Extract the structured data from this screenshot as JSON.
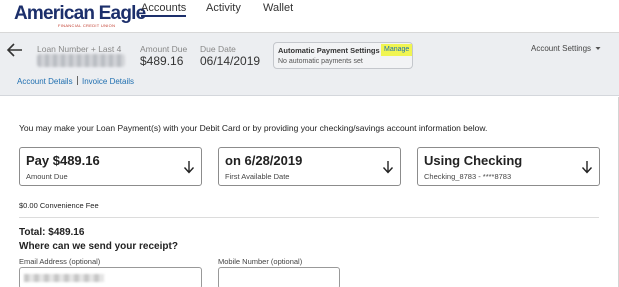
{
  "brand": {
    "name": "American Eagle",
    "tagline": "FINANCIAL CREDIT UNION"
  },
  "nav": {
    "items": [
      {
        "label": "Accounts",
        "active": true
      },
      {
        "label": "Activity"
      },
      {
        "label": "Wallet"
      }
    ]
  },
  "loan": {
    "loan_number_label": "Loan Number + Last 4",
    "amount_due_label": "Amount Due",
    "amount_due": "$489.16",
    "due_date_label": "Due Date",
    "due_date": "06/14/2019"
  },
  "autopay": {
    "title": "Automatic Payment Settings",
    "manage_label": "Manage",
    "status": "No automatic payments set"
  },
  "account_settings_label": "Account Settings",
  "subnav": {
    "account_details": "Account Details",
    "invoice_details": "Invoice Details"
  },
  "payment": {
    "intro": "You may make your Loan Payment(s) with your Debit Card or by providing your checking/savings account information below.",
    "cards": [
      {
        "title": "Pay $489.16",
        "subtitle": "Amount Due"
      },
      {
        "title": "on 6/28/2019",
        "subtitle": "First Available Date"
      },
      {
        "title": "Using Checking",
        "subtitle": "Checking_8783 - ****8783"
      }
    ],
    "fee": "$0.00 Convenience Fee",
    "total": "Total: $489.16",
    "receipt_heading": "Where can we send your receipt?",
    "email_label": "Email Address (optional)",
    "mobile_label": "Mobile Number (optional)"
  },
  "colors": {
    "brand_navy": "#1c2f6b",
    "link_blue": "#1f6fb0",
    "highlight": "#f0f552",
    "loanbar_bg": "#eceef1"
  },
  "icons": {
    "back": "arrow-left-icon",
    "dropdown": "caret-down-icon",
    "card_arrow": "arrow-down-icon"
  }
}
